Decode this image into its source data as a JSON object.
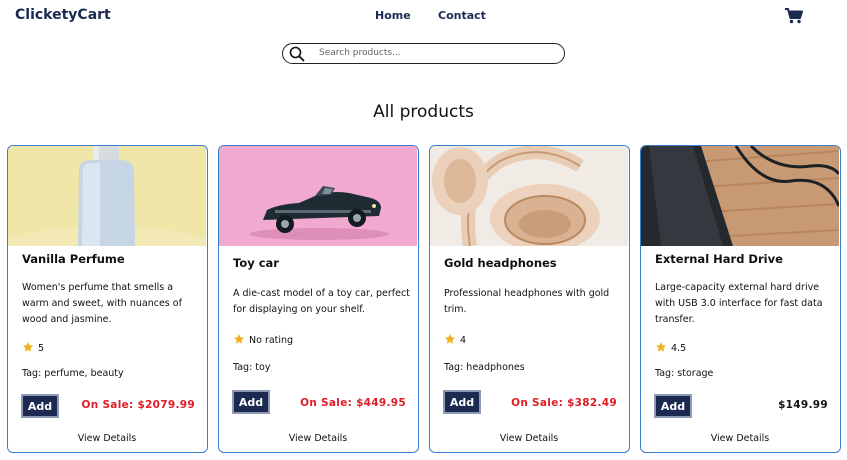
{
  "header": {
    "brand": "ClicketyCart",
    "nav": [
      {
        "label": "Home"
      },
      {
        "label": "Contact"
      }
    ],
    "cart_icon": "shopping-cart-icon"
  },
  "search": {
    "placeholder": "Search products...",
    "value": "",
    "icon": "search-icon"
  },
  "page": {
    "title": "All products"
  },
  "colors": {
    "brand": "#1c2a52",
    "sale_price": "#e01b24",
    "card_border": "#3b7fd0",
    "star": "#f2b01e"
  },
  "products": [
    {
      "title": "Vanilla Perfume",
      "description": "Women's perfume that smells a warm and sweet, with nuances of wood and jasmine.",
      "rating": "5",
      "tag": "Tag: perfume, beauty",
      "add_label": "Add",
      "price": "On Sale: $2079.99",
      "details_label": "View Details"
    },
    {
      "title": "Toy car",
      "description": "A die-cast model of a toy car, perfect for displaying on your shelf.",
      "rating": "No rating",
      "tag": "Tag: toy",
      "add_label": "Add",
      "price": "On Sale: $449.95",
      "details_label": "View Details"
    },
    {
      "title": "Gold headphones",
      "description": "Professional headphones with gold trim.",
      "rating": "4",
      "tag": "Tag: headphones",
      "add_label": "Add",
      "price": "On Sale: $382.49",
      "details_label": "View Details"
    },
    {
      "title": "External Hard Drive",
      "description": "Large-capacity external hard drive with USB 3.0 interface for fast data transfer.",
      "rating": "4.5",
      "tag": "Tag: storage",
      "add_label": "Add",
      "price": "$149.99",
      "details_label": "View Details"
    }
  ]
}
